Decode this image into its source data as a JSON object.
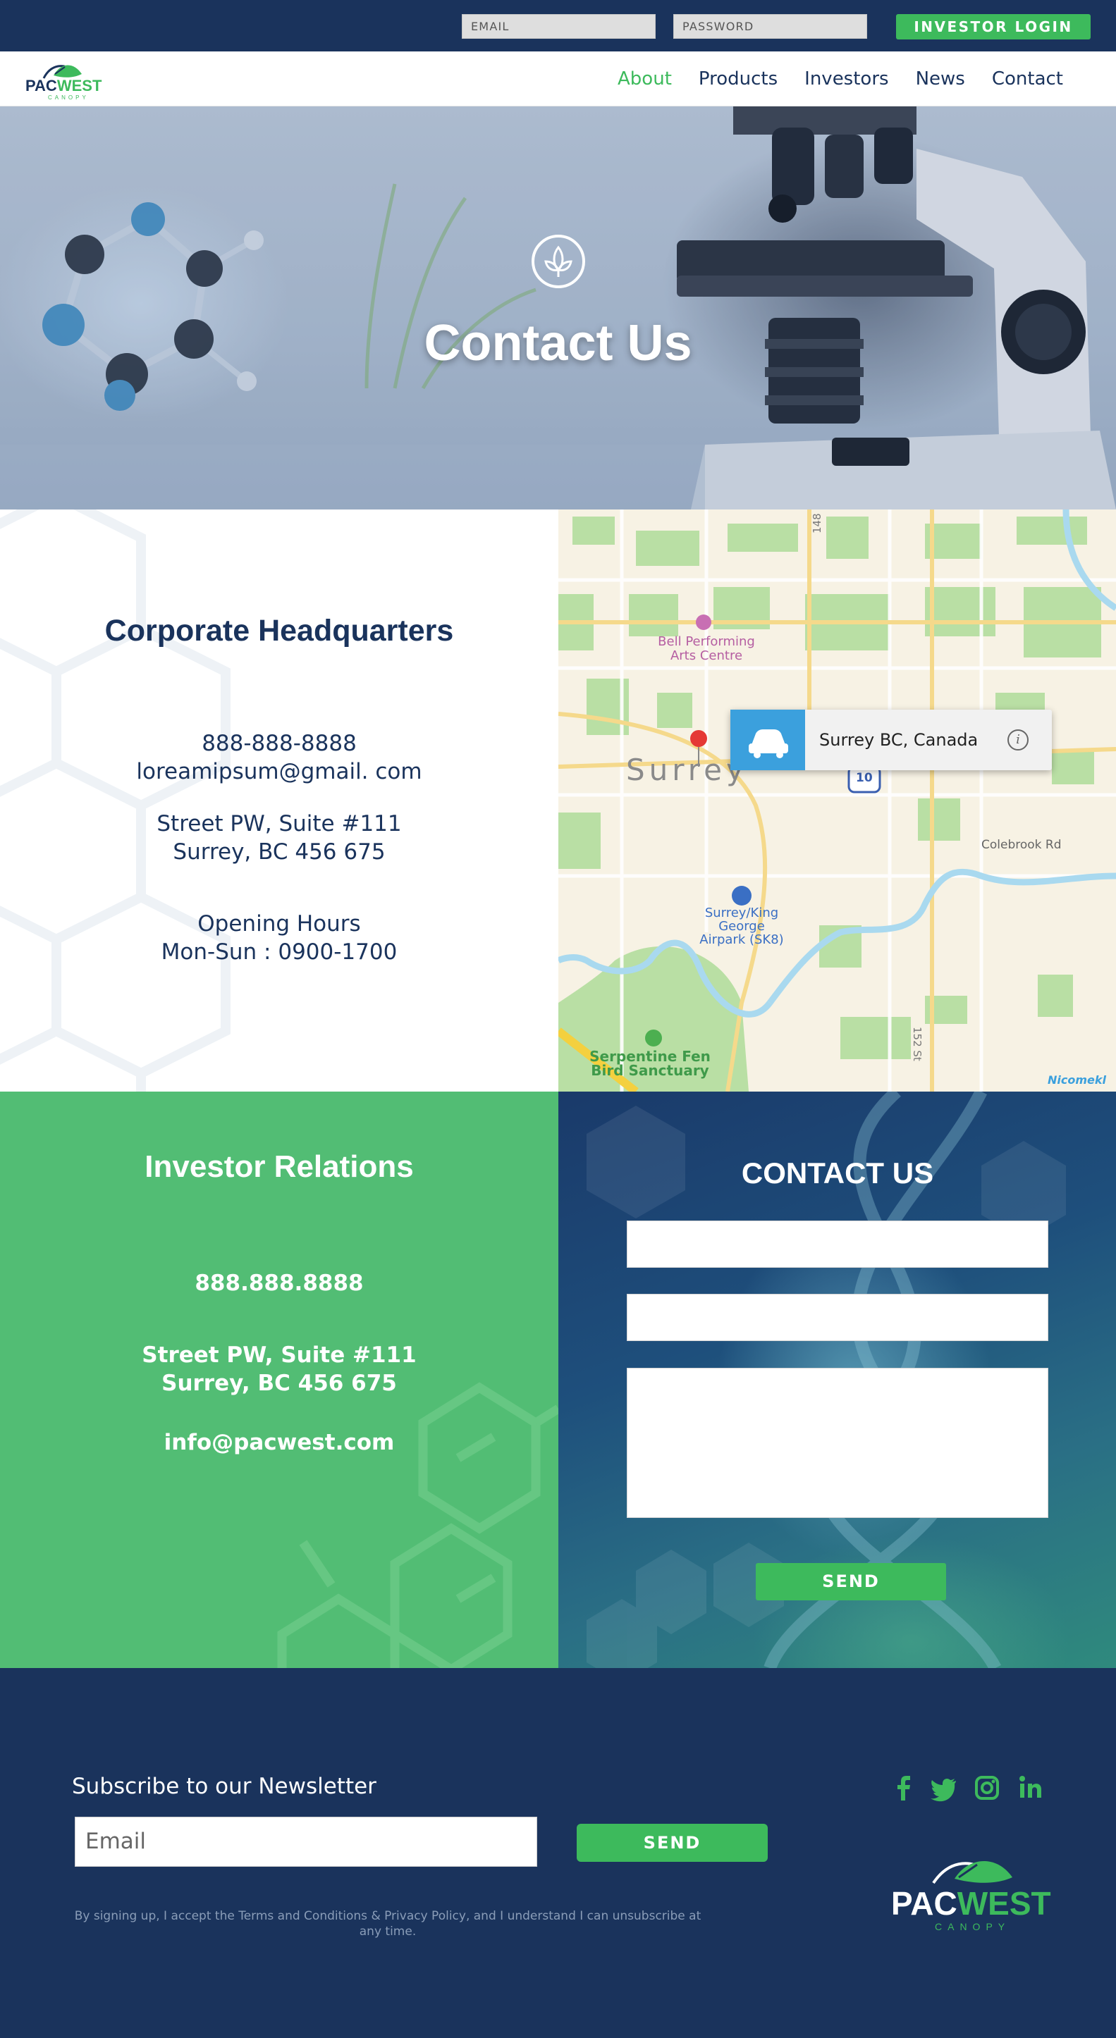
{
  "topbar": {
    "email_placeholder": "EMAIL",
    "password_placeholder": "PASSWORD",
    "login_label": "INVESTOR LOGIN"
  },
  "brand": {
    "name_part1": "PAC",
    "name_part2": "WEST",
    "tagline": "CANOPY",
    "colors": {
      "navy": "#1a335c",
      "green": "#3dba5c",
      "light_green": "#52bd74"
    }
  },
  "nav": {
    "items": [
      {
        "label": "About",
        "active": true
      },
      {
        "label": "Products",
        "active": false
      },
      {
        "label": "Investors",
        "active": false
      },
      {
        "label": "News",
        "active": false
      },
      {
        "label": "Contact",
        "active": false
      }
    ]
  },
  "hero": {
    "title": "Contact Us",
    "icon": "leaf-icon"
  },
  "hq": {
    "title": "Corporate Headquarters",
    "phone": "888-888-8888",
    "email": "loreamipsum@gmail. com",
    "address_line1": "Street PW, Suite #111",
    "address_line2": "Surrey, BC 456 675",
    "hours_title": "Opening Hours",
    "hours": "Mon-Sun : 0900-1700"
  },
  "map": {
    "popup_text": "Surrey BC, Canada",
    "labels": {
      "city": "Surrey",
      "poi1": "Bell Performing",
      "poi1b": "Arts Centre",
      "airport1": "Surrey/King",
      "airport2": "George",
      "airport3": "Airpark (SK8)",
      "sanctuary1": "Serpentine Fen",
      "sanctuary2": "Bird Sanctuary",
      "road1": "Colebrook Rd",
      "street1": "148 St",
      "street2": "152 St",
      "highway": "10",
      "corner": "Nicomekl"
    }
  },
  "investor": {
    "title": "Investor Relations",
    "phone": "888.888.8888",
    "address_line1": "Street PW, Suite #111",
    "address_line2": "Surrey, BC 456 675",
    "email": "info@pacwest.com"
  },
  "contact_form": {
    "title": "CONTACT US",
    "send_label": "SEND"
  },
  "footer": {
    "newsletter_title": "Subscribe to our Newsletter",
    "email_placeholder": "Email",
    "send_label": "SEND",
    "disclaimer": "By signing up, I accept the Terms and Conditions & Privacy Policy, and I understand I can unsubscribe at any time.",
    "social": [
      "facebook-icon",
      "twitter-icon",
      "instagram-icon",
      "linkedin-icon"
    ]
  }
}
